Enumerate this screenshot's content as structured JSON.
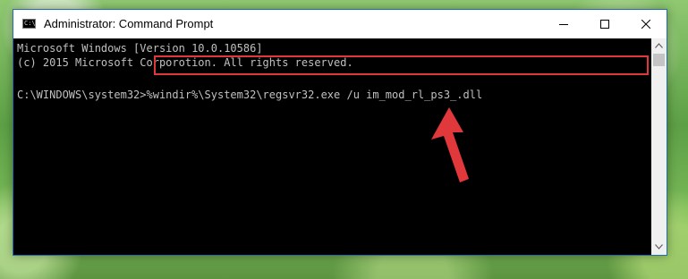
{
  "window": {
    "title": "Administrator: Command Prompt",
    "icon": "command-prompt-icon",
    "icon_glyph": "C:\\"
  },
  "controls": {
    "minimize_icon": "minimize-icon",
    "maximize_icon": "maximize-icon",
    "close_icon": "close-icon"
  },
  "console": {
    "lines": [
      "Microsoft Windows [Version 10.0.10586]",
      "(c) 2015 Microsoft Corporotion. All rights reserved."
    ],
    "prompt": "C:\\WINDOWS\\system32>",
    "command": "%windir%\\System32\\regsvr32.exe /u im_mod_rl_ps3_.dll"
  },
  "annotation": {
    "highlight_color": "#e0373b",
    "arrow_color": "#e0373b"
  }
}
